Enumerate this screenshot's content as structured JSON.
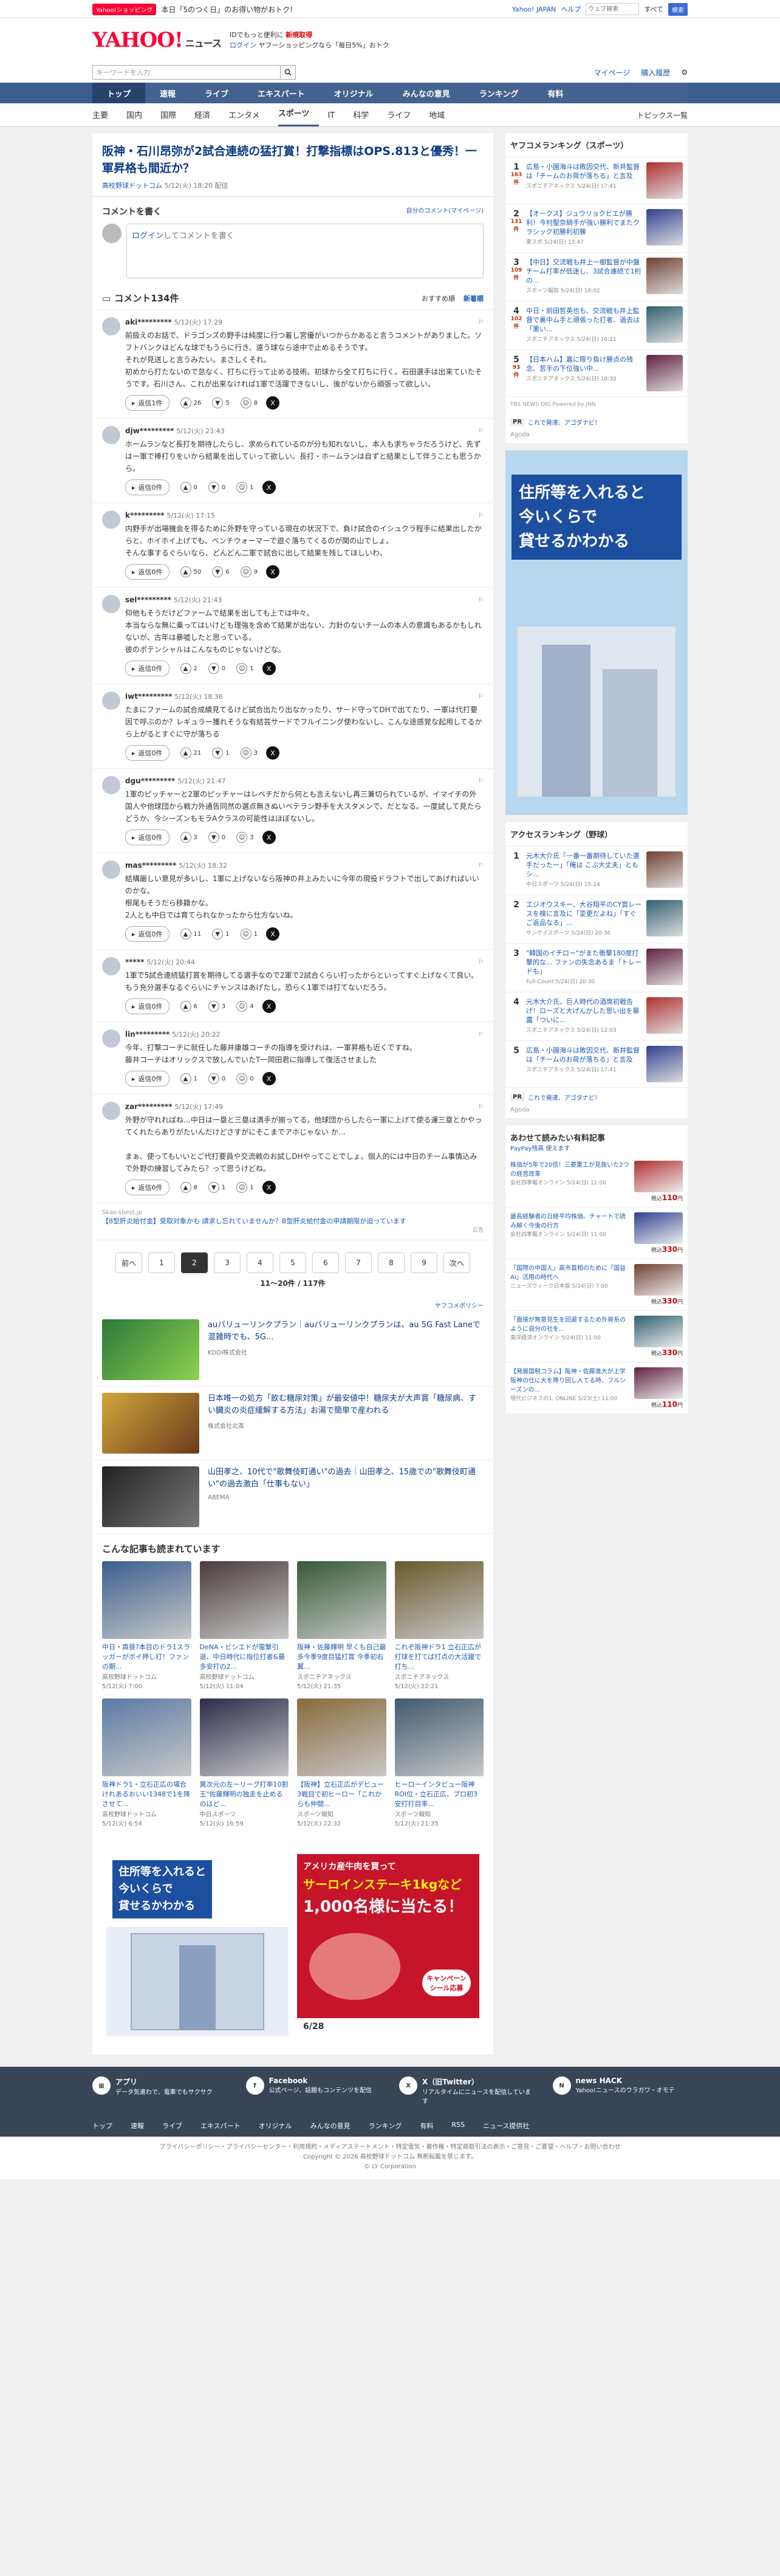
{
  "promo": {
    "pill": "Yahoo!ショッピング",
    "text": "本日「5のつく日」のお得い物がおトク!",
    "links": [
      "Yahoo! JAPAN",
      "ヘルプ"
    ],
    "search_placeholder": "ウェブ検索",
    "search_label": "検索",
    "toggle": "すべて"
  },
  "brand": {
    "logo": "YAHOO!",
    "service": "ニュース",
    "line1": "IDでもっと便利に",
    "line1b": "新規取得",
    "line2": "ログイン",
    "line2b": "ヤフーショッピングなら「毎日5%」おトク"
  },
  "search": {
    "placeholder": "キーワードを入力",
    "links": [
      "マイページ",
      "購入履歴"
    ]
  },
  "nav1": [
    "トップ",
    "速報",
    "ライブ",
    "エキスパート",
    "オリジナル",
    "みんなの意見",
    "ランキング",
    "有料"
  ],
  "nav2": [
    "主要",
    "国内",
    "国際",
    "経済",
    "エンタメ",
    "スポーツ",
    "IT",
    "科学",
    "ライフ",
    "地域"
  ],
  "nav2_active": 5,
  "nav2_more": "トピックス一覧",
  "article": {
    "title": "阪神・石川昂弥が2試合連続の猛打賞！打撃指標はOPS.813と優秀！一軍昇格も間近か？",
    "source": "高校野球ドットコム",
    "date": "5/12(火) 18:20 配信"
  },
  "comment_box": {
    "title": "コメントを書く",
    "mine": "自分のコメント(マイページ)",
    "login": "ログイン",
    "placeholder": "してコメントを書く"
  },
  "comments_header": {
    "title": "コメント134件",
    "sort1": "おすすめ順",
    "sort2": "新着順"
  },
  "comments": [
    {
      "user": "aki*********",
      "time": "5/12(火) 17:29",
      "text": "前扱えのお話で、ドラゴンズの野手は純度に行つ着し宮優がいつからかあると言うコメントがありました。ソフトバンクはどんな球でもうらに行き、遠う球なら途中で止めるそうです。\nそれが見送しと言うみたい。まさしくそれ。\n初めから打たないので怠なく、打ちに行って止める技術。初球から全て打ちに行く。石田選手は出来ていたそうです。石川さん、これが出来なければ1軍で活躍できないし、後がないから頑張って欲しい。",
      "replies": "返信1件",
      "good": "26",
      "bad": "5",
      "more": "8"
    },
    {
      "user": "djw*********",
      "time": "5/12(火) 23:43",
      "text": "ホームランなど長打を期待したらし、求められているのが分も知れないし、本人も求ちゃうだろうけど、先ずは一軍で棒打りをいから結果を出していって欲しい。長打・ホームランは自ずと結果として伴うことも思うから。",
      "replies": "返信0件",
      "good": "0",
      "bad": "0",
      "more": "1"
    },
    {
      "user": "k*********",
      "time": "5/12(火) 17:15",
      "text": "内野手が出場機会を得るために外野を守っている現在の状況下で、負け試合のイシュクラ程手に結果出したからと、ホイホイ上げても、ベンチウォーマーで遊ぐ落ちてくるのが関の山でしょ。\nそんな事するぐらいなら、どんどん二軍で試合に出して結果を残してほしいわ。",
      "replies": "返信0件",
      "good": "50",
      "bad": "6",
      "more": "9"
    },
    {
      "user": "sel*********",
      "time": "5/12(火) 21:43",
      "text": "仰他もそうだけどファームで結果を出しても上では中々。\n本当ならな無に乗ってはいけども理強を含めて結果が出ない、力針のないチームの本人の意識もあるかもしれないが、古年は暴嘘したと思っている。\n彼のポテンシャルはこんなものじゃないけどな。",
      "replies": "返信0件",
      "good": "2",
      "bad": "0",
      "more": "1"
    },
    {
      "user": "iwt*********",
      "time": "5/12(火) 18:36",
      "text": "たまにファームの試合成績見てるけど試合出たり出なかったり、サード守ってDHで出てたり、一軍は代打要因で呼ぶのか？レギュラー獲れそうな有結芸サードでフルイニング使わないし、こんな途感覚な起用してるから上がるとすぐに守が落ちる",
      "replies": "返信0件",
      "good": "21",
      "bad": "1",
      "more": "3"
    },
    {
      "user": "dgu*********",
      "time": "5/12(火) 21:47",
      "text": "1軍のピッチャーと2軍のピッチャーはレベチだから何とも言えないし再三兼切られているが、イマイチの外国人や他球団から戦力外通告同然の選点無きぬいベテラン野手を大スタメンで、だとなる。一度試して見たらどうか、今シーズンもモラAクラスの可能性はほぼないし。",
      "replies": "返信0件",
      "good": "3",
      "bad": "0",
      "more": "3"
    },
    {
      "user": "mas*********",
      "time": "5/12(火) 18:32",
      "text": "結構厳しい意見が多いし、1軍に上げないなら阪神の井上みたいに今年の現役ドラフトで出してあげればいいのかな。\n根尾もそうだら移籍かな。\n2人とも中日では育てられなかったから仕方ないね。",
      "replies": "返信0件",
      "good": "11",
      "bad": "1",
      "more": "1"
    },
    {
      "user": "*****",
      "time": "5/12(火) 20:44",
      "text": "1軍で5試合連続猛打賞を期待してる選手なので2軍で2試合くらい打ったからといってすぐ上げなくて良い。もう充分選手なるぐらいにチャンスはあげたし。恐らく1軍では打てないだろう。",
      "replies": "返信0件",
      "good": "6",
      "bad": "3",
      "more": "4"
    },
    {
      "user": "lin*********",
      "time": "5/12(火) 20:22",
      "text": "今年、打撃コーチに就任した藤井康雄コーチの指導を受けれは、一軍昇格も近くですね。\n藤井コーチはオリックスで放しんでいたT一岡田君に指導して復活させました",
      "replies": "返信0件",
      "good": "1",
      "bad": "0",
      "more": "0"
    },
    {
      "user": "zar*********",
      "time": "5/12(火) 17:49",
      "text": "外野が守れればね…中日は一塁と三塁は満手が揃ってる。他球団からしたら一軍に上げて使る運三塁とかやってくれたらありがたいんだけどさすがにそこまでアホじゃない か…\n\nまぁ、使ってもいいとご代打要員や交流戦のお試しDHやってことでしょ。個人的には中日のチーム事情込みで外野の練習してみたら？って思うけどね。",
      "replies": "返信0件",
      "good": "8",
      "bad": "1",
      "more": "1"
    }
  ],
  "pr_comment": {
    "src": "Skas-sbest.jp",
    "text": "【8型肝炎給付金】受取対象かも 請求し忘れていませんか？B型肝炎給付金の申請期限が迫っています",
    "tag": "広告"
  },
  "pagination": {
    "prev": "前へ",
    "pages": [
      "1",
      "2",
      "3",
      "4",
      "5",
      "6",
      "7",
      "8",
      "9"
    ],
    "active": "2",
    "next": "次へ",
    "count": "11〜20件 / 117件"
  },
  "ads": {
    "label": "ヤフコメポリシー",
    "items": [
      {
        "title": "auバリューリンクプラン｜auバリューリンクプランは、au 5G Fast Laneで混雑時でも、5G...",
        "src": "KDDI株式会社"
      },
      {
        "title": "日本唯一の処方「飲む糖尿対策」が最安値中！糖尿夫が大声賞「糖尿病、すい臓炎の炎症緩解する方法」お湯で簡単で産われる",
        "src": "株式会社北斎"
      },
      {
        "title": "山田孝之、10代で\"歌舞伎町通い\"の過去｜山田孝之、15歳での\"歌舞伎町通い\"の過去激白「仕事もない」",
        "src": "ABEMA"
      }
    ]
  },
  "related": {
    "title": "こんな記事も読まれています",
    "items": [
      {
        "title": "中日・真昼?本目のドラ1スラッガーがボイ押し打！ファンの期...",
        "src": "高校野球ドットコム",
        "date": "5/12(火) 7:00"
      },
      {
        "title": "DeNA・ビシエドが電撃引退、中日時代に指位打者&最多安打の2...",
        "src": "高校野球ドットコム",
        "date": "5/12(火) 11:04"
      },
      {
        "title": "阪神・佐藤輝明 早くも自己最多今季9度目猛打賞 今季初右翼...",
        "src": "スポニチアネックス",
        "date": "5/12(火) 21:35"
      },
      {
        "title": "これぞ阪神ドラ1 立石正広が打球を打てば打点の大活躍で打ち...",
        "src": "スポニチアネックス",
        "date": "5/12(火) 22:21"
      },
      {
        "title": "阪神ドラ1・立石正広の場合けれあるおいい1348で1を降させて...",
        "src": "高校野球ドットコム",
        "date": "5/12(火) 6:54"
      },
      {
        "title": "異次元の左ーリーグ打率10割王\"佐藤輝明の独走を止めるのはど...",
        "src": "中日スポーツ",
        "date": "5/12(火) 16:59"
      },
      {
        "title": "【阪神】立石正広がデビュー3戦目で初ヒーロー「これからも仲間...",
        "src": "スポーツ報知",
        "date": "5/12(火) 22:32"
      },
      {
        "title": "ヒーローインタビュー阪神ROI位・立石正広、プロ初3安打打目率...",
        "src": "スポーツ報知",
        "date": "5/12(火) 21:35"
      }
    ]
  },
  "banner_ads": [
    {
      "l1": "住所等を入れると",
      "l2": "今いくらで",
      "l3": "貸せるかわかる"
    },
    {
      "l1": "アメリカ産牛肉を買って",
      "l2": "サーロインステーキ1kgなど",
      "l3": "1,000名様に当たる！",
      "l4": "キャンペーン シール応募",
      "l5": "6/28"
    }
  ],
  "side_rank": {
    "title": "ヤフコメランキング（スポーツ）",
    "items": [
      {
        "n": "1",
        "cnt": "163件",
        "t": "広島・小園海斗は敗因交代、新井監督は「チームのお荷が落ちる」と言及",
        "s": "スポニチアネックス 5/24(日) 17:41"
      },
      {
        "n": "2",
        "cnt": "131件",
        "t": "【オークス】ジュウリョクビエが勝利！今村聖奈騎手が強い勝利でまたクラシック初勝利初勝",
        "s": "東スポ 5/24(日) 13:47"
      },
      {
        "n": "3",
        "cnt": "109件",
        "t": "【中日】交流戦も井上一樹監督が中盤 チーム打率が低迷し、3試合連続で1桁の...",
        "s": "スポーツ報知 5/24(日) 18:02"
      },
      {
        "n": "4",
        "cnt": "102件",
        "t": "中日・前田哲英也も、交流戦も井上監督で裏中ム手と頑張った打者、過去は「悪い...",
        "s": "スポニチアネックス 5/24(日) 16:21"
      },
      {
        "n": "5",
        "cnt": "93件",
        "t": "【日本ハム】嘉に限り負け勝点の残念、苦手の下位強い中...",
        "s": "スポニチアネックス 5/24(日) 18:30"
      }
    ],
    "source": "TBS NEWS DIG Powered by JNN",
    "pr": "これで発達、アゴダナビ！",
    "pr_src": "Agoda"
  },
  "access_rank": {
    "title": "アクセスランキング（野球）",
    "items": [
      {
        "n": "1",
        "t": "元木大介氏「一番一番期待していた選手だったー」「俺は こぶ大丈夫」ともシ...",
        "s": "中日スポーツ 5/24(日) 15:24"
      },
      {
        "n": "2",
        "t": "エジオウスキー、大谷翔平のCY賞レースを検に言及に「変更だよね」「すぐご返品なる」...",
        "s": "サンケイスポーツ 5/24(日) 20:36"
      },
      {
        "n": "3",
        "t": "\"韓国のイチロー\"がまた衝撃180度打撃的な... ファンの失念あるま「トレードも」",
        "s": "Full-Count 5/24(日) 20:30"
      },
      {
        "n": "4",
        "t": "元木大介氏、巨人時代の酒席初戦告げ！ローズと大げんかした思い出を暴露「ついに...",
        "s": "スポニチアネックス 5/24(日) 12:03"
      },
      {
        "n": "5",
        "t": "広島・小園海斗は敗因交代、新井監督は「チームのお荷が落ちる」と言及",
        "s": "スポニチアネックス 5/24(日) 17:41"
      }
    ],
    "pr": "これで発達、アゴダナビ！",
    "pr_src": "Agoda"
  },
  "market": {
    "title": "あわせて読みたい有料記事",
    "sub": "PayPay残高 使えます",
    "items": [
      {
        "t": "株価が5年で20倍！三菱重工が見抜いた2つの経営改革",
        "s": "会社四季報オンライン 5/24(日) 11:00",
        "p": "110"
      },
      {
        "t": "最長経験者の日経平均株価、チャートで読み解く今後の行方",
        "s": "会社四季報オンライン 5/24(日) 11:00",
        "p": "330"
      },
      {
        "t": "「国際の中国人」高市首相のために「国益AI」活用の時代へ",
        "s": "ニューズウィーク日本版 5/24(日) 7:00",
        "p": "330"
      },
      {
        "t": "「面接が無意見生を回避するため外資系のように自分の社を...",
        "s": "東洋経済オンライン 5/24(日) 11:00",
        "p": "330"
      },
      {
        "t": "【発展国税コラム】阪神・佐藤進大が上学 阪神の仕に大を降り回し人てる時、フルシーズンの...",
        "s": "現代ビジネスの1, ONLINE 5/23(土) 11:00",
        "p": "110"
      }
    ],
    "currency": "税込"
  },
  "foot": {
    "items": [
      {
        "t": "アプリ",
        "d": "データ気遣わで、電車でもサクサク"
      },
      {
        "t": "Facebook",
        "d": "公式ページ、話題もコンテンツを配信"
      },
      {
        "t": "X（旧Twitter）",
        "d": "リアルタイムにニュースを配信しています"
      },
      {
        "t": "news HACK",
        "d": "Yahoo!ニュースのウラガワ・オモテ"
      }
    ],
    "links": [
      "トップ",
      "速報",
      "ライブ",
      "エキスパート",
      "オリジナル",
      "みんなの意見",
      "ランキング",
      "有料",
      "RSS",
      "ニュース提供社"
    ],
    "copy1": "プライバシーポリシー・プライバシーセンター・利用規約・メディアステートメント・特定電気・著作権・特定商取引法の表示・ご意見・ご要望・ヘルプ・お問い合わせ",
    "copy2": "Copyright © 2026 高校野球ドットコム 無断転載を禁じます。",
    "copy3": "© LY Corporation"
  }
}
